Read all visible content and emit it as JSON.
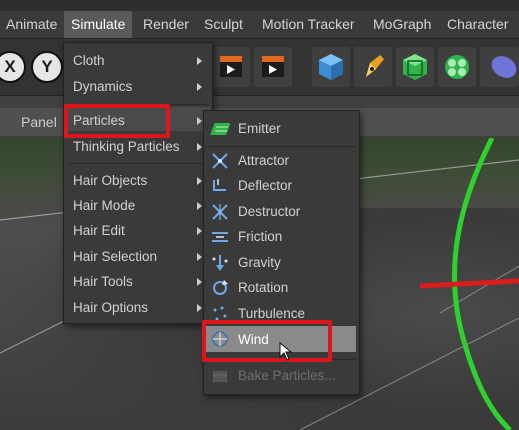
{
  "menubar": {
    "items": [
      "Animate",
      "Simulate",
      "Render",
      "Sculpt",
      "Motion Tracker",
      "MoGraph",
      "Character"
    ],
    "active": "Simulate"
  },
  "toolbar": {
    "axis_x": "X",
    "axis_y": "Y"
  },
  "subbar": {
    "panel_label": "Panel"
  },
  "simulate_menu": {
    "items": [
      {
        "label": "Cloth",
        "submenu": true
      },
      {
        "label": "Dynamics",
        "submenu": true
      },
      {
        "label": "Particles",
        "submenu": true,
        "highlighted": true
      },
      {
        "label": "Thinking Particles",
        "submenu": true
      },
      {
        "label": "Hair Objects",
        "submenu": true
      },
      {
        "label": "Hair Mode",
        "submenu": true
      },
      {
        "label": "Hair Edit",
        "submenu": true
      },
      {
        "label": "Hair Selection",
        "submenu": true
      },
      {
        "label": "Hair Tools",
        "submenu": true
      },
      {
        "label": "Hair Options",
        "submenu": true
      }
    ]
  },
  "particles_menu": {
    "items": [
      {
        "label": "Emitter",
        "icon": "emitter-icon"
      },
      {
        "label": "Attractor",
        "icon": "attractor-icon"
      },
      {
        "label": "Deflector",
        "icon": "deflector-icon"
      },
      {
        "label": "Destructor",
        "icon": "destructor-icon"
      },
      {
        "label": "Friction",
        "icon": "friction-icon"
      },
      {
        "label": "Gravity",
        "icon": "gravity-icon"
      },
      {
        "label": "Rotation",
        "icon": "rotation-icon"
      },
      {
        "label": "Turbulence",
        "icon": "turbulence-icon"
      },
      {
        "label": "Wind",
        "icon": "wind-icon",
        "highlighted": true
      },
      {
        "label": "Bake Particles...",
        "icon": "bake-particles-icon",
        "disabled": true
      }
    ]
  },
  "colors": {
    "highlight_box": "#e0151b",
    "green_guide": "#2ed12e",
    "red_guide": "#d91c1c"
  }
}
